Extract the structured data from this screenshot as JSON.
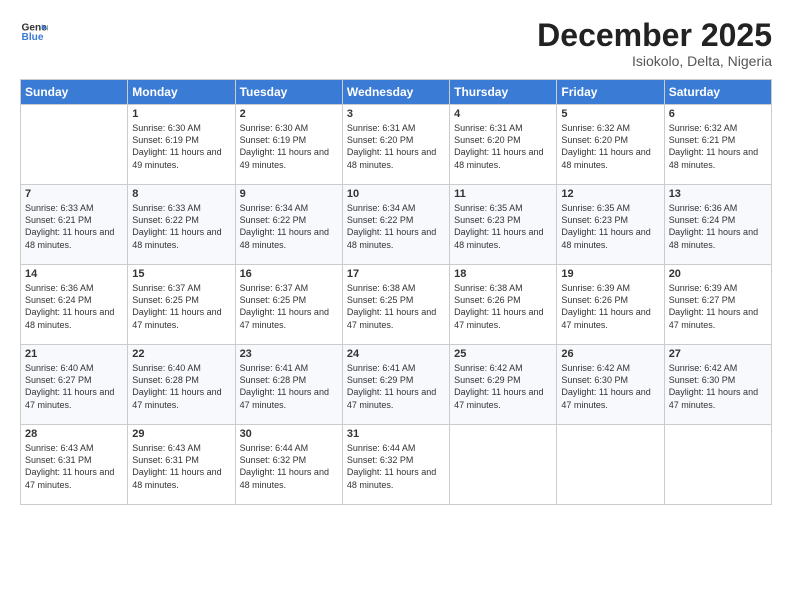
{
  "logo": {
    "line1": "General",
    "line2": "Blue"
  },
  "title": "December 2025",
  "subtitle": "Isiokolo, Delta, Nigeria",
  "header_days": [
    "Sunday",
    "Monday",
    "Tuesday",
    "Wednesday",
    "Thursday",
    "Friday",
    "Saturday"
  ],
  "weeks": [
    [
      {
        "day": "",
        "sunrise": "",
        "sunset": "",
        "daylight": ""
      },
      {
        "day": "1",
        "sunrise": "Sunrise: 6:30 AM",
        "sunset": "Sunset: 6:19 PM",
        "daylight": "Daylight: 11 hours and 49 minutes."
      },
      {
        "day": "2",
        "sunrise": "Sunrise: 6:30 AM",
        "sunset": "Sunset: 6:19 PM",
        "daylight": "Daylight: 11 hours and 49 minutes."
      },
      {
        "day": "3",
        "sunrise": "Sunrise: 6:31 AM",
        "sunset": "Sunset: 6:20 PM",
        "daylight": "Daylight: 11 hours and 48 minutes."
      },
      {
        "day": "4",
        "sunrise": "Sunrise: 6:31 AM",
        "sunset": "Sunset: 6:20 PM",
        "daylight": "Daylight: 11 hours and 48 minutes."
      },
      {
        "day": "5",
        "sunrise": "Sunrise: 6:32 AM",
        "sunset": "Sunset: 6:20 PM",
        "daylight": "Daylight: 11 hours and 48 minutes."
      },
      {
        "day": "6",
        "sunrise": "Sunrise: 6:32 AM",
        "sunset": "Sunset: 6:21 PM",
        "daylight": "Daylight: 11 hours and 48 minutes."
      }
    ],
    [
      {
        "day": "7",
        "sunrise": "Sunrise: 6:33 AM",
        "sunset": "Sunset: 6:21 PM",
        "daylight": "Daylight: 11 hours and 48 minutes."
      },
      {
        "day": "8",
        "sunrise": "Sunrise: 6:33 AM",
        "sunset": "Sunset: 6:22 PM",
        "daylight": "Daylight: 11 hours and 48 minutes."
      },
      {
        "day": "9",
        "sunrise": "Sunrise: 6:34 AM",
        "sunset": "Sunset: 6:22 PM",
        "daylight": "Daylight: 11 hours and 48 minutes."
      },
      {
        "day": "10",
        "sunrise": "Sunrise: 6:34 AM",
        "sunset": "Sunset: 6:22 PM",
        "daylight": "Daylight: 11 hours and 48 minutes."
      },
      {
        "day": "11",
        "sunrise": "Sunrise: 6:35 AM",
        "sunset": "Sunset: 6:23 PM",
        "daylight": "Daylight: 11 hours and 48 minutes."
      },
      {
        "day": "12",
        "sunrise": "Sunrise: 6:35 AM",
        "sunset": "Sunset: 6:23 PM",
        "daylight": "Daylight: 11 hours and 48 minutes."
      },
      {
        "day": "13",
        "sunrise": "Sunrise: 6:36 AM",
        "sunset": "Sunset: 6:24 PM",
        "daylight": "Daylight: 11 hours and 48 minutes."
      }
    ],
    [
      {
        "day": "14",
        "sunrise": "Sunrise: 6:36 AM",
        "sunset": "Sunset: 6:24 PM",
        "daylight": "Daylight: 11 hours and 48 minutes."
      },
      {
        "day": "15",
        "sunrise": "Sunrise: 6:37 AM",
        "sunset": "Sunset: 6:25 PM",
        "daylight": "Daylight: 11 hours and 47 minutes."
      },
      {
        "day": "16",
        "sunrise": "Sunrise: 6:37 AM",
        "sunset": "Sunset: 6:25 PM",
        "daylight": "Daylight: 11 hours and 47 minutes."
      },
      {
        "day": "17",
        "sunrise": "Sunrise: 6:38 AM",
        "sunset": "Sunset: 6:25 PM",
        "daylight": "Daylight: 11 hours and 47 minutes."
      },
      {
        "day": "18",
        "sunrise": "Sunrise: 6:38 AM",
        "sunset": "Sunset: 6:26 PM",
        "daylight": "Daylight: 11 hours and 47 minutes."
      },
      {
        "day": "19",
        "sunrise": "Sunrise: 6:39 AM",
        "sunset": "Sunset: 6:26 PM",
        "daylight": "Daylight: 11 hours and 47 minutes."
      },
      {
        "day": "20",
        "sunrise": "Sunrise: 6:39 AM",
        "sunset": "Sunset: 6:27 PM",
        "daylight": "Daylight: 11 hours and 47 minutes."
      }
    ],
    [
      {
        "day": "21",
        "sunrise": "Sunrise: 6:40 AM",
        "sunset": "Sunset: 6:27 PM",
        "daylight": "Daylight: 11 hours and 47 minutes."
      },
      {
        "day": "22",
        "sunrise": "Sunrise: 6:40 AM",
        "sunset": "Sunset: 6:28 PM",
        "daylight": "Daylight: 11 hours and 47 minutes."
      },
      {
        "day": "23",
        "sunrise": "Sunrise: 6:41 AM",
        "sunset": "Sunset: 6:28 PM",
        "daylight": "Daylight: 11 hours and 47 minutes."
      },
      {
        "day": "24",
        "sunrise": "Sunrise: 6:41 AM",
        "sunset": "Sunset: 6:29 PM",
        "daylight": "Daylight: 11 hours and 47 minutes."
      },
      {
        "day": "25",
        "sunrise": "Sunrise: 6:42 AM",
        "sunset": "Sunset: 6:29 PM",
        "daylight": "Daylight: 11 hours and 47 minutes."
      },
      {
        "day": "26",
        "sunrise": "Sunrise: 6:42 AM",
        "sunset": "Sunset: 6:30 PM",
        "daylight": "Daylight: 11 hours and 47 minutes."
      },
      {
        "day": "27",
        "sunrise": "Sunrise: 6:42 AM",
        "sunset": "Sunset: 6:30 PM",
        "daylight": "Daylight: 11 hours and 47 minutes."
      }
    ],
    [
      {
        "day": "28",
        "sunrise": "Sunrise: 6:43 AM",
        "sunset": "Sunset: 6:31 PM",
        "daylight": "Daylight: 11 hours and 47 minutes."
      },
      {
        "day": "29",
        "sunrise": "Sunrise: 6:43 AM",
        "sunset": "Sunset: 6:31 PM",
        "daylight": "Daylight: 11 hours and 48 minutes."
      },
      {
        "day": "30",
        "sunrise": "Sunrise: 6:44 AM",
        "sunset": "Sunset: 6:32 PM",
        "daylight": "Daylight: 11 hours and 48 minutes."
      },
      {
        "day": "31",
        "sunrise": "Sunrise: 6:44 AM",
        "sunset": "Sunset: 6:32 PM",
        "daylight": "Daylight: 11 hours and 48 minutes."
      },
      {
        "day": "",
        "sunrise": "",
        "sunset": "",
        "daylight": ""
      },
      {
        "day": "",
        "sunrise": "",
        "sunset": "",
        "daylight": ""
      },
      {
        "day": "",
        "sunrise": "",
        "sunset": "",
        "daylight": ""
      }
    ]
  ]
}
